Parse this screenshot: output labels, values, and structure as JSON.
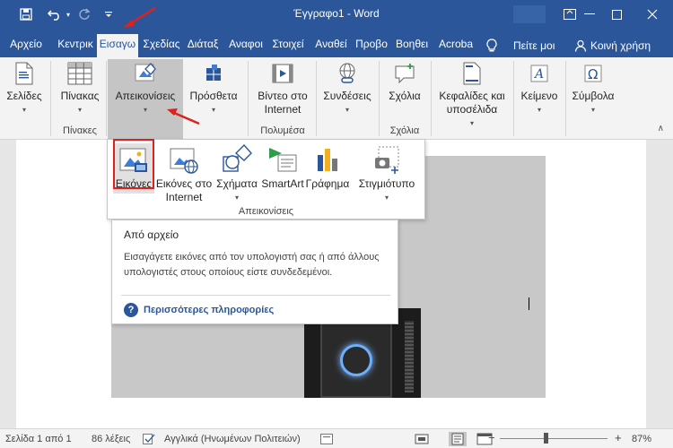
{
  "window": {
    "title": "Έγγραφο1  -  Word"
  },
  "tabs": [
    {
      "label": "Αρχείο"
    },
    {
      "label": "Κεντρικ"
    },
    {
      "label": "Εισαγω"
    },
    {
      "label": "Σχεδίας"
    },
    {
      "label": "Διάταξ"
    },
    {
      "label": "Αναφοι"
    },
    {
      "label": "Στοιχεί"
    },
    {
      "label": "Αναθεί"
    },
    {
      "label": "Προβο"
    },
    {
      "label": "Βοηθει"
    },
    {
      "label": "Acroba"
    }
  ],
  "tell_me": "Πείτε μοι",
  "share": "Κοινή χρήση",
  "ribbon": {
    "pages": "Σελίδες",
    "table": "Πίνακας",
    "tables_group": "Πίνακες",
    "illustrations": "Απεικονίσεις",
    "addins": "Πρόσθετα",
    "video_line1": "Βίντεο στο",
    "video_line2": "Internet",
    "media_group": "Πολυμέσα",
    "links": "Συνδέσεις",
    "comments": "Σχόλια",
    "comments_group": "Σχόλια",
    "header_line1": "Κεφαλίδες και",
    "header_line2": "υποσέλιδα",
    "text": "Κείμενο",
    "symbols": "Σύμβολα"
  },
  "gallery": {
    "items": [
      {
        "label": "Εικόνες"
      },
      {
        "label": "Εικόνες στο Internet"
      },
      {
        "label": "Σχήματα"
      },
      {
        "label": "SmartArt"
      },
      {
        "label": "Γράφημα"
      },
      {
        "label": "Στιγμιότυπο"
      }
    ],
    "group_label": "Απεικονίσεις"
  },
  "tooltip": {
    "title": "Από αρχείο",
    "body": "Εισαγάγετε εικόνες από τον υπολογιστή σας ή από άλλους υπολογιστές στους οποίους είστε συνδεδεμένοι.",
    "link": "Περισσότερες πληροφορίες"
  },
  "status": {
    "page": "Σελίδα 1 από 1",
    "words": "86 λέξεις",
    "language": "Αγγλικά (Ηνωμένων Πολιτειών)",
    "zoom": "87%",
    "zoom_percent": 87
  },
  "colors": {
    "accent": "#2b579a",
    "annotation": "#e0201c"
  }
}
